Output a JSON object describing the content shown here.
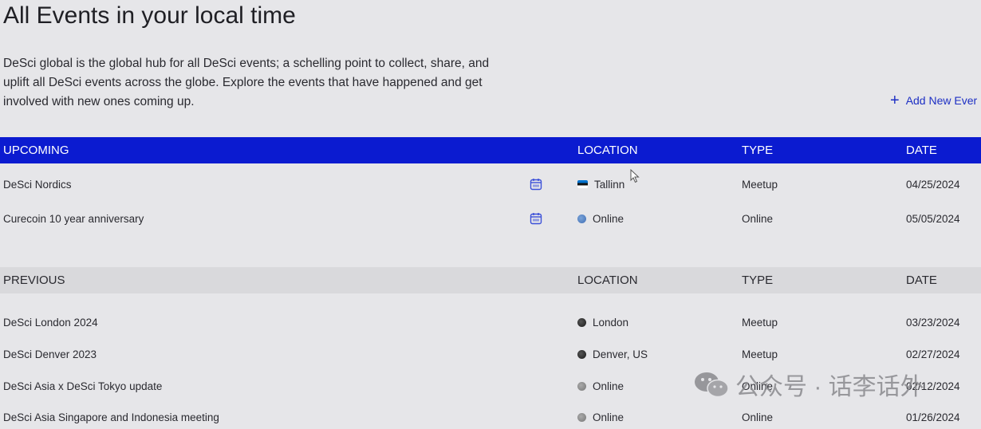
{
  "page": {
    "title": "All Events in your local time",
    "intro": "DeSci global is the global hub for all DeSci events; a schelling point to collect, share, and uplift all DeSci events across the globe. Explore the events that have happened and get involved with new ones coming up.",
    "add_link": "Add New Ever"
  },
  "upcoming": {
    "headers": {
      "name": "UPCOMING",
      "location": "LOCATION",
      "type": "TYPE",
      "date": "DATE"
    },
    "rows": [
      {
        "name": "DeSci Nordics",
        "location": "Tallinn",
        "type": "Meetup",
        "date": "04/25/2024",
        "loc_icon": "estonia-flag-icon"
      },
      {
        "name": "Curecoin 10 year anniversary",
        "location": "Online",
        "type": "Online",
        "date": "05/05/2024",
        "loc_icon": "globe-icon"
      }
    ]
  },
  "previous": {
    "headers": {
      "name": "PREVIOUS",
      "location": "LOCATION",
      "type": "TYPE",
      "date": "DATE"
    },
    "rows": [
      {
        "name": "DeSci London 2024",
        "location": "London",
        "type": "Meetup",
        "date": "03/23/2024",
        "loc_icon": "uk-flag-icon"
      },
      {
        "name": "DeSci Denver 2023",
        "location": "Denver, US",
        "type": "Meetup",
        "date": "02/27/2024",
        "loc_icon": "us-flag-icon"
      },
      {
        "name": "DeSci Asia x DeSci Tokyo update",
        "location": "Online",
        "type": "Online",
        "date": "02/12/2024",
        "loc_icon": "globe-icon"
      },
      {
        "name": "DeSci Asia Singapore and Indonesia meeting",
        "location": "Online",
        "type": "Online",
        "date": "01/26/2024",
        "loc_icon": "globe-icon"
      }
    ]
  },
  "watermark": {
    "text": "公众号 · 话李话外"
  },
  "colors": {
    "accent": "#0b1bd0",
    "link": "#1d2fc4",
    "background": "#e6e6e9"
  }
}
